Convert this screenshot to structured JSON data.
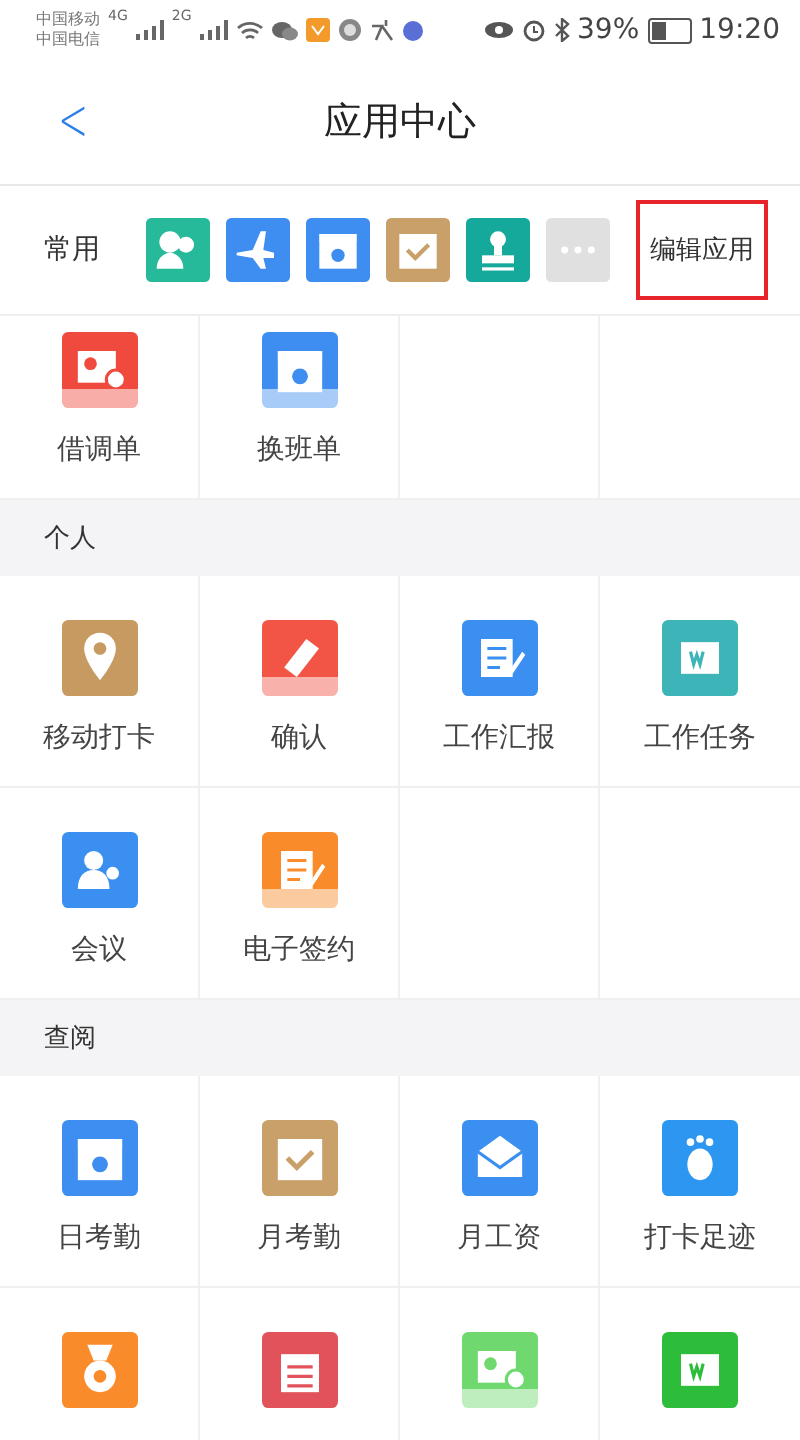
{
  "status_bar": {
    "carriers": [
      "中国移动",
      "中国电信"
    ],
    "networks": [
      "4G",
      "2G"
    ],
    "battery": "39%",
    "time": "19:20"
  },
  "header": {
    "back": "<",
    "title": "应用中心"
  },
  "favorites": {
    "label": "常用",
    "apps": [
      {
        "kind": "people",
        "color": "#26b99a"
      },
      {
        "kind": "plane",
        "color": "#3d8ef0"
      },
      {
        "kind": "calendar",
        "color": "#3d8ef0"
      },
      {
        "kind": "check",
        "color": "#c9a06a"
      },
      {
        "kind": "stamp",
        "color": "#14a99a"
      },
      {
        "kind": "more",
        "color": "#e0e0e0"
      }
    ],
    "edit_button": {
      "label": "编辑应用",
      "outlined": true
    }
  },
  "sections": [
    {
      "apps": [
        {
          "kind": "card",
          "color": "#f04a3e",
          "locked": true,
          "label": "借调单"
        },
        {
          "kind": "calendar",
          "color": "#3d8ef0",
          "locked": true,
          "label": "换班单"
        }
      ]
    },
    {
      "title": "个人",
      "apps": [
        {
          "kind": "pin",
          "color": "#c79a62",
          "locked": false,
          "label": "移动打卡"
        },
        {
          "kind": "tag",
          "color": "#f25545",
          "locked": true,
          "label": "确认"
        },
        {
          "kind": "report",
          "color": "#3a8ff0",
          "locked": false,
          "label": "工作汇报"
        },
        {
          "kind": "document",
          "color": "#3db5b8",
          "locked": false,
          "label": "工作任务"
        },
        {
          "kind": "person",
          "color": "#3a8ff0",
          "locked": false,
          "label": "会议"
        },
        {
          "kind": "report",
          "color": "#f98b2a",
          "locked": true,
          "label": "电子签约"
        }
      ]
    },
    {
      "title": "查阅",
      "apps": [
        {
          "kind": "calendar",
          "color": "#3d8ef0",
          "locked": false,
          "label": "日考勤"
        },
        {
          "kind": "check",
          "color": "#c9a06a",
          "locked": false,
          "label": "月考勤"
        },
        {
          "kind": "envelope",
          "color": "#3a8ff0",
          "locked": false,
          "label": "月工资"
        },
        {
          "kind": "foot",
          "color": "#2d96f0",
          "locked": false,
          "label": "打卡足迹"
        },
        {
          "kind": "medal",
          "color": "#f98b2a",
          "locked": false
        },
        {
          "kind": "list",
          "color": "#e2525a",
          "locked": false
        },
        {
          "kind": "card",
          "color": "#6fd86f",
          "locked": true
        },
        {
          "kind": "document",
          "color": "#2ebd3a",
          "locked": false
        }
      ]
    }
  ]
}
